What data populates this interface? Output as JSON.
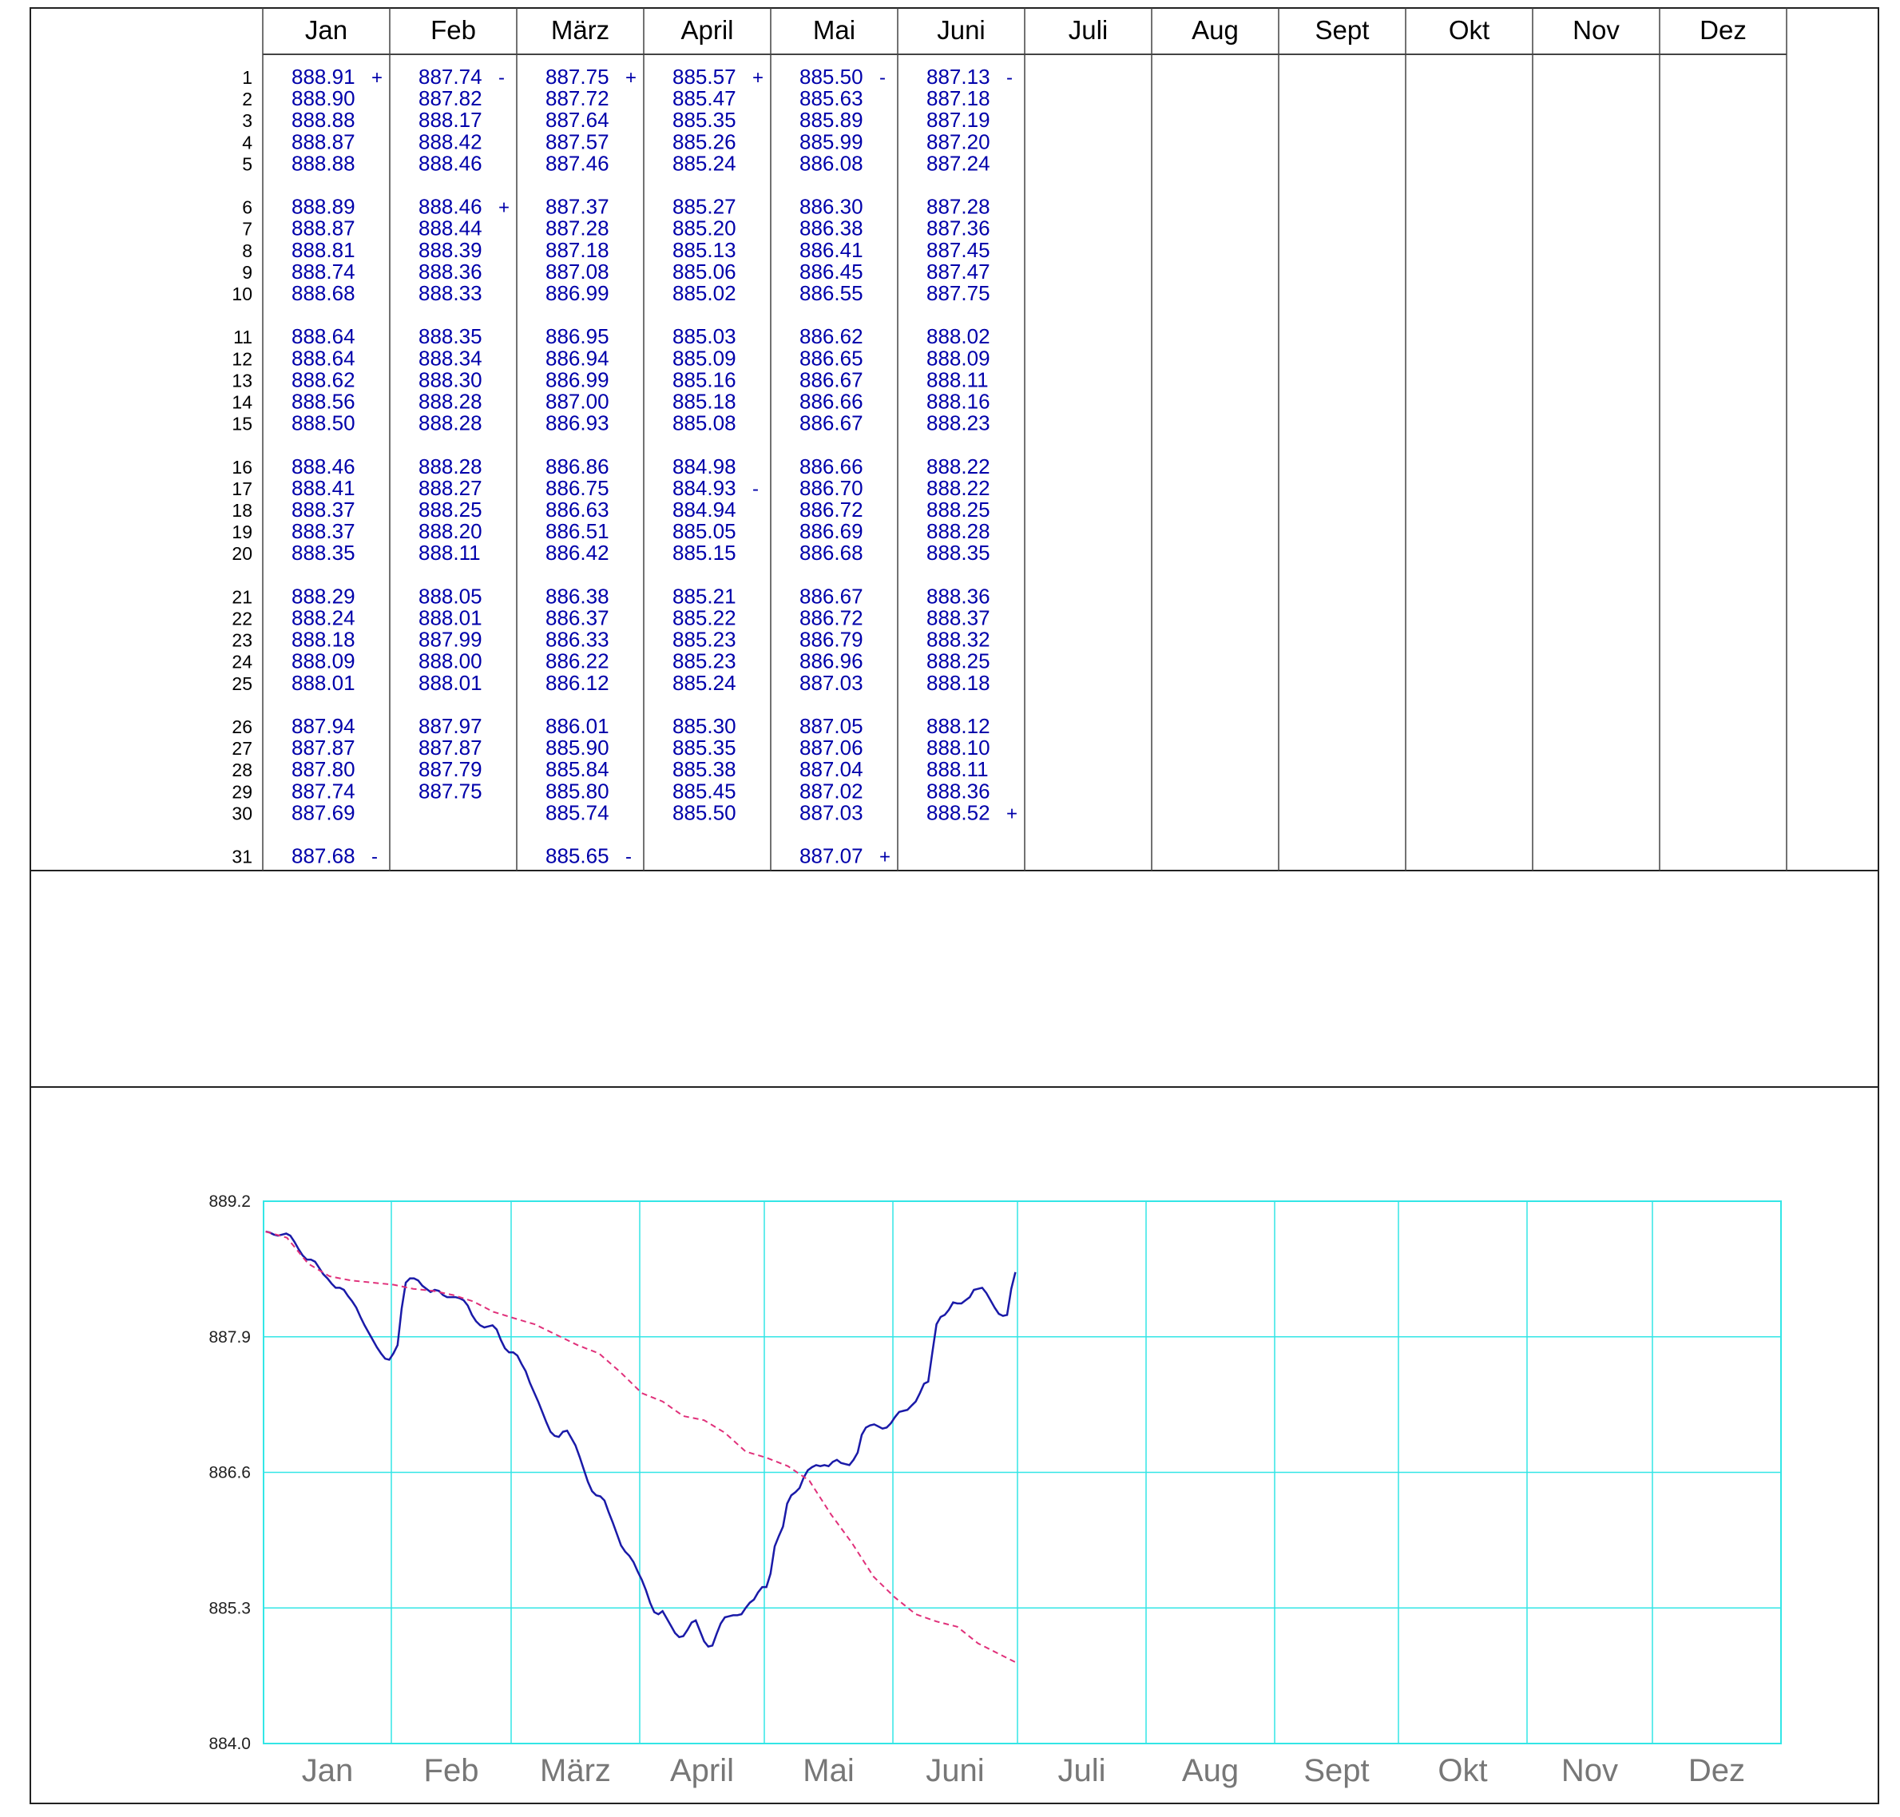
{
  "table": {
    "months": [
      "Jan",
      "Feb",
      "März",
      "April",
      "Mai",
      "Juni",
      "Juli",
      "Aug",
      "Sept",
      "Okt",
      "Nov",
      "Dez"
    ],
    "day_numbers": [
      "1",
      "2",
      "3",
      "4",
      "5",
      "6",
      "7",
      "8",
      "9",
      "10",
      "11",
      "12",
      "13",
      "14",
      "15",
      "16",
      "17",
      "18",
      "19",
      "20",
      "21",
      "22",
      "23",
      "24",
      "25",
      "26",
      "27",
      "28",
      "29",
      "30",
      "31"
    ],
    "columns": [
      {
        "month": "Jan",
        "values": [
          "888.91",
          "888.90",
          "888.88",
          "888.87",
          "888.88",
          "888.89",
          "888.87",
          "888.81",
          "888.74",
          "888.68",
          "888.64",
          "888.64",
          "888.62",
          "888.56",
          "888.50",
          "888.46",
          "888.41",
          "888.37",
          "888.37",
          "888.35",
          "888.29",
          "888.24",
          "888.18",
          "888.09",
          "888.01",
          "887.94",
          "887.87",
          "887.80",
          "887.74",
          "887.69",
          "887.68"
        ],
        "marks": [
          {
            "day": 1,
            "sign": "+"
          },
          {
            "day": 31,
            "sign": "-"
          }
        ]
      },
      {
        "month": "Feb",
        "values": [
          "887.74",
          "887.82",
          "888.17",
          "888.42",
          "888.46",
          "888.46",
          "888.44",
          "888.39",
          "888.36",
          "888.33",
          "888.35",
          "888.34",
          "888.30",
          "888.28",
          "888.28",
          "888.28",
          "888.27",
          "888.25",
          "888.20",
          "888.11",
          "888.05",
          "888.01",
          "887.99",
          "888.00",
          "888.01",
          "887.97",
          "887.87",
          "887.79",
          "887.75"
        ],
        "marks": [
          {
            "day": 1,
            "sign": "-"
          },
          {
            "day": 6,
            "sign": "+"
          }
        ]
      },
      {
        "month": "März",
        "values": [
          "887.75",
          "887.72",
          "887.64",
          "887.57",
          "887.46",
          "887.37",
          "887.28",
          "887.18",
          "887.08",
          "886.99",
          "886.95",
          "886.94",
          "886.99",
          "887.00",
          "886.93",
          "886.86",
          "886.75",
          "886.63",
          "886.51",
          "886.42",
          "886.38",
          "886.37",
          "886.33",
          "886.22",
          "886.12",
          "886.01",
          "885.90",
          "885.84",
          "885.80",
          "885.74",
          "885.65"
        ],
        "marks": [
          {
            "day": 1,
            "sign": "+"
          },
          {
            "day": 31,
            "sign": "-"
          }
        ]
      },
      {
        "month": "April",
        "values": [
          "885.57",
          "885.47",
          "885.35",
          "885.26",
          "885.24",
          "885.27",
          "885.20",
          "885.13",
          "885.06",
          "885.02",
          "885.03",
          "885.09",
          "885.16",
          "885.18",
          "885.08",
          "884.98",
          "884.93",
          "884.94",
          "885.05",
          "885.15",
          "885.21",
          "885.22",
          "885.23",
          "885.23",
          "885.24",
          "885.30",
          "885.35",
          "885.38",
          "885.45",
          "885.50"
        ],
        "marks": [
          {
            "day": 1,
            "sign": "+"
          },
          {
            "day": 17,
            "sign": "-"
          }
        ]
      },
      {
        "month": "Mai",
        "values": [
          "885.50",
          "885.63",
          "885.89",
          "885.99",
          "886.08",
          "886.30",
          "886.38",
          "886.41",
          "886.45",
          "886.55",
          "886.62",
          "886.65",
          "886.67",
          "886.66",
          "886.67",
          "886.66",
          "886.70",
          "886.72",
          "886.69",
          "886.68",
          "886.67",
          "886.72",
          "886.79",
          "886.96",
          "887.03",
          "887.05",
          "887.06",
          "887.04",
          "887.02",
          "887.03",
          "887.07"
        ],
        "marks": [
          {
            "day": 1,
            "sign": "-"
          },
          {
            "day": 31,
            "sign": "+"
          }
        ]
      },
      {
        "month": "Juni",
        "values": [
          "887.13",
          "887.18",
          "887.19",
          "887.20",
          "887.24",
          "887.28",
          "887.36",
          "887.45",
          "887.47",
          "887.75",
          "888.02",
          "888.09",
          "888.11",
          "888.16",
          "888.23",
          "888.22",
          "888.22",
          "888.25",
          "888.28",
          "888.35",
          "888.36",
          "888.37",
          "888.32",
          "888.25",
          "888.18",
          "888.12",
          "888.10",
          "888.11",
          "888.36",
          "888.52"
        ],
        "marks": [
          {
            "day": 1,
            "sign": "-"
          },
          {
            "day": 30,
            "sign": "+"
          }
        ]
      },
      {
        "month": "Juli",
        "values": [],
        "marks": []
      },
      {
        "month": "Aug",
        "values": [],
        "marks": []
      },
      {
        "month": "Sept",
        "values": [],
        "marks": []
      },
      {
        "month": "Okt",
        "values": [],
        "marks": []
      },
      {
        "month": "Nov",
        "values": [],
        "marks": []
      },
      {
        "month": "Dez",
        "values": [],
        "marks": []
      }
    ]
  },
  "chart_data": {
    "type": "line",
    "title": "",
    "xlabel": "",
    "ylabel": "",
    "ylim": [
      884.0,
      889.2
    ],
    "yticks": [
      "889.2",
      "887.9",
      "886.6",
      "885.3",
      "884.0"
    ],
    "categories": [
      "Jan",
      "Feb",
      "März",
      "April",
      "Mai",
      "Juni",
      "Juli",
      "Aug",
      "Sept",
      "Okt",
      "Nov",
      "Dez"
    ],
    "grid": true,
    "colors": {
      "observed": "#1a1aa8",
      "reference": "#e0307a",
      "grid": "#33e6e6"
    },
    "series": [
      {
        "name": "",
        "style": "solid",
        "source": "daily values from table (Jan–Juni)"
      },
      {
        "name": "",
        "style": "dashed",
        "points": [
          {
            "month": 0,
            "day": 1,
            "value": 888.91
          },
          {
            "month": 0,
            "day": 6,
            "value": 888.85
          },
          {
            "month": 0,
            "day": 11,
            "value": 888.6
          },
          {
            "month": 0,
            "day": 16,
            "value": 888.48
          },
          {
            "month": 0,
            "day": 21,
            "value": 888.44
          },
          {
            "month": 0,
            "day": 26,
            "value": 888.42
          },
          {
            "month": 1,
            "day": 1,
            "value": 888.4
          },
          {
            "month": 1,
            "day": 6,
            "value": 888.36
          },
          {
            "month": 1,
            "day": 11,
            "value": 888.34
          },
          {
            "month": 1,
            "day": 16,
            "value": 888.3
          },
          {
            "month": 1,
            "day": 21,
            "value": 888.24
          },
          {
            "month": 1,
            "day": 26,
            "value": 888.14
          },
          {
            "month": 2,
            "day": 1,
            "value": 888.08
          },
          {
            "month": 2,
            "day": 6,
            "value": 888.02
          },
          {
            "month": 2,
            "day": 11,
            "value": 887.92
          },
          {
            "month": 2,
            "day": 16,
            "value": 887.82
          },
          {
            "month": 2,
            "day": 21,
            "value": 887.74
          },
          {
            "month": 2,
            "day": 26,
            "value": 887.56
          },
          {
            "month": 3,
            "day": 1,
            "value": 887.36
          },
          {
            "month": 3,
            "day": 6,
            "value": 887.28
          },
          {
            "month": 3,
            "day": 11,
            "value": 887.14
          },
          {
            "month": 3,
            "day": 16,
            "value": 887.1
          },
          {
            "month": 3,
            "day": 21,
            "value": 886.98
          },
          {
            "month": 3,
            "day": 26,
            "value": 886.8
          },
          {
            "month": 4,
            "day": 1,
            "value": 886.74
          },
          {
            "month": 4,
            "day": 6,
            "value": 886.66
          },
          {
            "month": 4,
            "day": 11,
            "value": 886.52
          },
          {
            "month": 4,
            "day": 16,
            "value": 886.2
          },
          {
            "month": 4,
            "day": 21,
            "value": 885.92
          },
          {
            "month": 4,
            "day": 26,
            "value": 885.6
          },
          {
            "month": 5,
            "day": 1,
            "value": 885.4
          },
          {
            "month": 5,
            "day": 6,
            "value": 885.24
          },
          {
            "month": 5,
            "day": 11,
            "value": 885.17
          },
          {
            "month": 5,
            "day": 16,
            "value": 885.12
          },
          {
            "month": 5,
            "day": 21,
            "value": 884.96
          },
          {
            "month": 5,
            "day": 30,
            "value": 884.78
          }
        ]
      }
    ]
  }
}
